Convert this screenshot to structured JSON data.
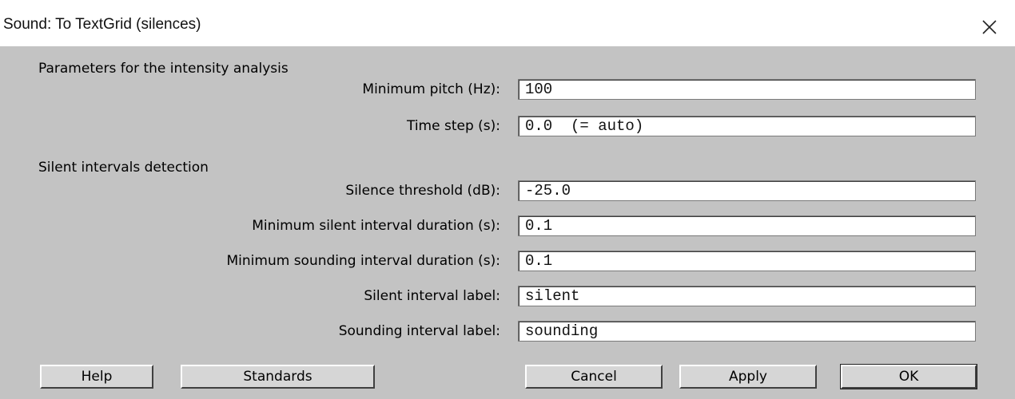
{
  "window": {
    "title": "Sound: To TextGrid (silences)",
    "close_icon": "close-icon"
  },
  "sections": {
    "intensity": "Parameters for the intensity analysis",
    "silent": "Silent intervals detection"
  },
  "fields": [
    {
      "label": "Minimum pitch (Hz):",
      "value": "100"
    },
    {
      "label": "Time step (s):",
      "value": "0.0  (= auto)"
    },
    {
      "label": "Silence threshold (dB):",
      "value": "-25.0"
    },
    {
      "label": "Minimum silent interval duration (s):",
      "value": "0.1"
    },
    {
      "label": "Minimum sounding interval duration (s):",
      "value": "0.1"
    },
    {
      "label": "Silent interval label:",
      "value": "silent"
    },
    {
      "label": "Sounding interval label:",
      "value": "sounding"
    }
  ],
  "buttons": {
    "help": "Help",
    "standards": "Standards",
    "cancel": "Cancel",
    "apply": "Apply",
    "ok": "OK"
  }
}
